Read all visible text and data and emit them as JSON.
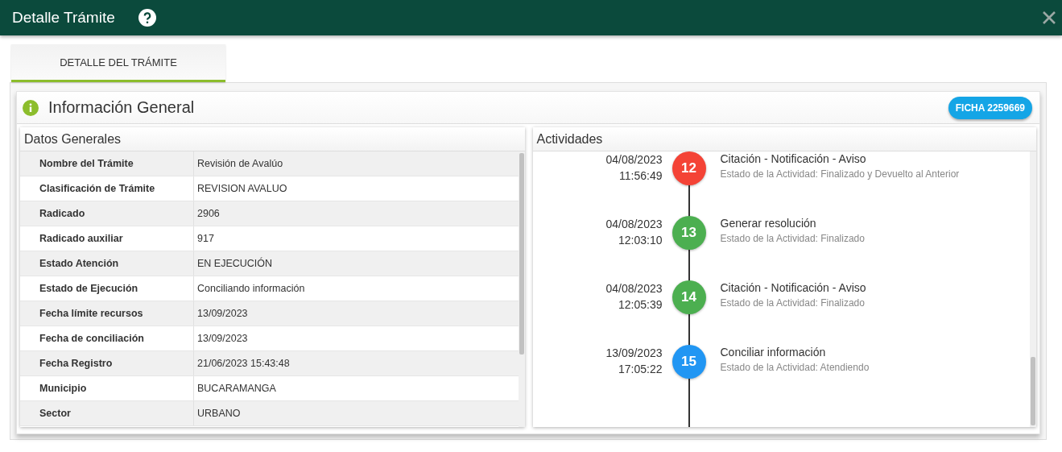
{
  "window": {
    "title": "Detalle Trámite"
  },
  "tabs": [
    {
      "label": "DETALLE DEL TRÁMITE",
      "selected": true
    }
  ],
  "section": {
    "title": "Información General",
    "badge": "FICHA 2259669"
  },
  "datos_generales": {
    "title": "Datos Generales",
    "rows": [
      {
        "label": "Nombre del Trámite",
        "value": "Revisión de Avalúo"
      },
      {
        "label": "Clasificación de Trámite",
        "value": "REVISION AVALUO"
      },
      {
        "label": "Radicado",
        "value": "2906"
      },
      {
        "label": "Radicado auxiliar",
        "value": "917"
      },
      {
        "label": "Estado Atención",
        "value": "EN EJECUCIÓN"
      },
      {
        "label": "Estado de Ejecución",
        "value": "Conciliando información"
      },
      {
        "label": "Fecha límite recursos",
        "value": "13/09/2023"
      },
      {
        "label": "Fecha de conciliación",
        "value": "13/09/2023"
      },
      {
        "label": "Fecha Registro",
        "value": "21/06/2023 15:43:48"
      },
      {
        "label": "Municipio",
        "value": "BUCARAMANGA"
      },
      {
        "label": "Sector",
        "value": "URBANO"
      }
    ]
  },
  "actividades": {
    "title": "Actividades",
    "items": [
      {
        "date": "04/08/2023",
        "time": "11:56:49",
        "number": "12",
        "color": "#f44336",
        "title": "Citación - Notificación - Aviso",
        "status": "Estado de la Actividad: Finalizado y Devuelto al Anterior"
      },
      {
        "date": "04/08/2023",
        "time": "12:03:10",
        "number": "13",
        "color": "#4caf50",
        "title": "Generar resolución",
        "status": "Estado de la Actividad: Finalizado"
      },
      {
        "date": "04/08/2023",
        "time": "12:05:39",
        "number": "14",
        "color": "#4caf50",
        "title": "Citación - Notificación - Aviso",
        "status": "Estado de la Actividad: Finalizado"
      },
      {
        "date": "13/09/2023",
        "time": "17:05:22",
        "number": "15",
        "color": "#2196f3",
        "title": "Conciliar información",
        "status": "Estado de la Actividad: Atendiendo"
      }
    ]
  }
}
